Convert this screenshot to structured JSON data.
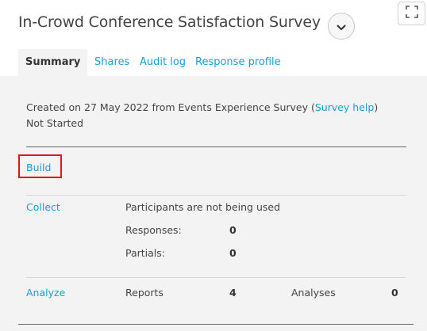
{
  "survey": {
    "title": "In-Crowd Conference Satisfaction Survey"
  },
  "tabs": [
    {
      "label": "Summary",
      "active": true
    },
    {
      "label": "Shares",
      "active": false
    },
    {
      "label": "Audit log",
      "active": false
    },
    {
      "label": "Response profile",
      "active": false
    }
  ],
  "summary": {
    "created_prefix": "Created on 27 May 2022 from Events Experience Survey (",
    "survey_help_link": "Survey help",
    "created_suffix": ")",
    "status": "Not Started"
  },
  "build": {
    "label": "Build"
  },
  "collect": {
    "label": "Collect",
    "participants_note": "Participants are not being used",
    "responses_label": "Responses:",
    "responses_value": "0",
    "partials_label": "Partials:",
    "partials_value": "0"
  },
  "analyze": {
    "label": "Analyze",
    "reports_label": "Reports",
    "reports_value": "4",
    "analyses_label": "Analyses",
    "analyses_value": "0"
  },
  "icons": {
    "dropdown": "chevron-down-icon",
    "expand": "expand-icon"
  },
  "colors": {
    "link": "#1a9fd0",
    "highlight_box": "#e0161f",
    "panel_bg": "#f3f3f3"
  }
}
